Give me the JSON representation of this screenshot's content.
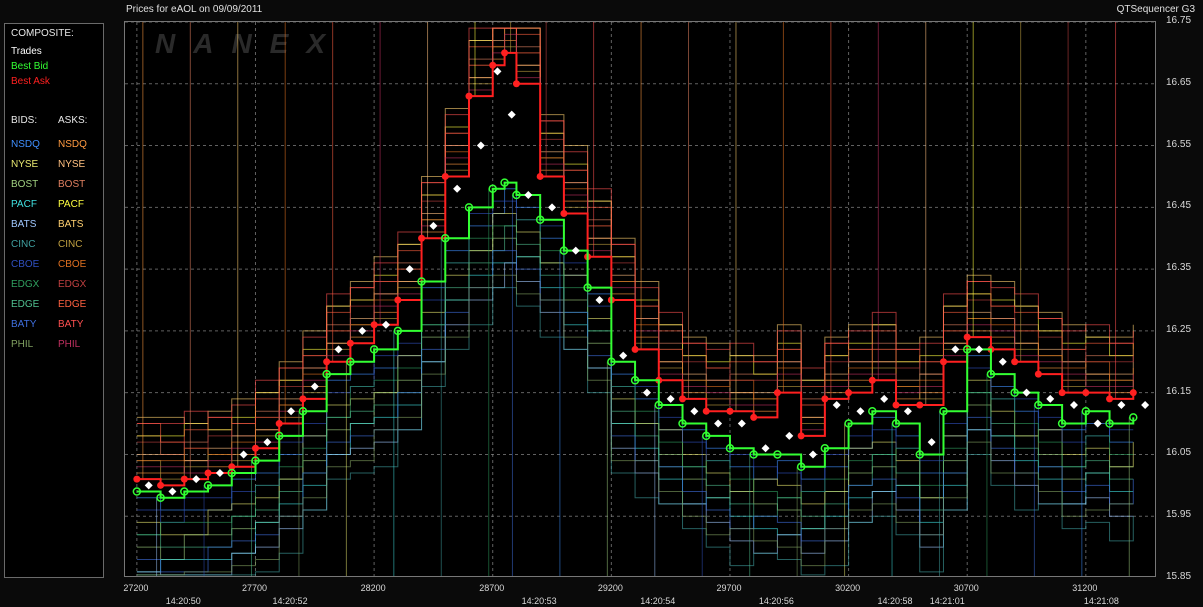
{
  "header": {
    "title_left": "Prices for  eAOL  on  09/09/2011",
    "title_right": "QTSequencer G3"
  },
  "legend": {
    "composite_label": "COMPOSITE:",
    "composite": [
      {
        "name": "Trades",
        "color": "#ffffff"
      },
      {
        "name": "Best Bid",
        "color": "#33ff33"
      },
      {
        "name": "Best Ask",
        "color": "#ff2020"
      }
    ],
    "bids_label": "BIDS:",
    "asks_label": "ASKS:",
    "exchanges": [
      {
        "bid": "NSDQ",
        "ask": "NSDQ",
        "bid_color": "#3f8fff",
        "ask_color": "#ff9a40"
      },
      {
        "bid": "NYSE",
        "ask": "NYSE",
        "bid_color": "#e8e870",
        "ask_color": "#ffc080"
      },
      {
        "bid": "BOST",
        "ask": "BOST",
        "bid_color": "#a0d080",
        "ask_color": "#e08060"
      },
      {
        "bid": "PACF",
        "ask": "PACF",
        "bid_color": "#40e0e0",
        "ask_color": "#ffff40"
      },
      {
        "bid": "BATS",
        "ask": "BATS",
        "bid_color": "#a0c8ff",
        "ask_color": "#ffd070"
      },
      {
        "bid": "CINC",
        "ask": "CINC",
        "bid_color": "#40a0a0",
        "ask_color": "#c0a040"
      },
      {
        "bid": "CBOE",
        "ask": "CBOE",
        "bid_color": "#3050c0",
        "ask_color": "#e07020"
      },
      {
        "bid": "EDGX",
        "ask": "EDGX",
        "bid_color": "#30a060",
        "ask_color": "#c04040"
      },
      {
        "bid": "EDGE",
        "ask": "EDGE",
        "bid_color": "#50c090",
        "ask_color": "#ff6040"
      },
      {
        "bid": "BATY",
        "ask": "BATY",
        "bid_color": "#4070e0",
        "ask_color": "#ff5050"
      },
      {
        "bid": "PHIL",
        "ask": "PHIL",
        "bid_color": "#80a060",
        "ask_color": "#c03060"
      }
    ]
  },
  "watermark": "NANEX",
  "chart_data": {
    "type": "line",
    "title": "Prices for  eAOL  on  09/09/2011",
    "xlim": [
      27150,
      31500
    ],
    "ylim": [
      15.85,
      16.75
    ],
    "y_ticks": [
      "16.75",
      "16.65",
      "16.55",
      "16.45",
      "16.35",
      "16.25",
      "16.15",
      "16.05",
      "15.95",
      "15.85"
    ],
    "x_ticks": [
      "27200",
      "27700",
      "28200",
      "28700",
      "29200",
      "29700",
      "30200",
      "30700",
      "31200"
    ],
    "time_ticks": [
      {
        "label": "14:20:50",
        "x": 27400
      },
      {
        "label": "14:20:52",
        "x": 27850
      },
      {
        "label": "14:20:53",
        "x": 28900
      },
      {
        "label": "14:20:54",
        "x": 29400
      },
      {
        "label": "14:20:56",
        "x": 29900
      },
      {
        "label": "14:20:58",
        "x": 30400
      },
      {
        "label": "14:21:01",
        "x": 30620
      },
      {
        "label": "14:21:08",
        "x": 31270
      }
    ],
    "series": [
      {
        "name": "Best Ask",
        "color": "#ff2020",
        "x": [
          27200,
          27300,
          27400,
          27500,
          27600,
          27700,
          27800,
          27900,
          28000,
          28100,
          28200,
          28300,
          28400,
          28500,
          28600,
          28700,
          28750,
          28800,
          28900,
          29000,
          29100,
          29200,
          29300,
          29400,
          29500,
          29600,
          29700,
          29800,
          29900,
          30000,
          30100,
          30200,
          30300,
          30400,
          30500,
          30600,
          30700,
          30800,
          30900,
          31000,
          31100,
          31200,
          31300,
          31400
        ],
        "values": [
          16.01,
          16.0,
          16.01,
          16.02,
          16.03,
          16.06,
          16.1,
          16.14,
          16.2,
          16.23,
          16.26,
          16.3,
          16.4,
          16.5,
          16.63,
          16.68,
          16.7,
          16.65,
          16.5,
          16.44,
          16.37,
          16.3,
          16.22,
          16.17,
          16.14,
          16.12,
          16.12,
          16.11,
          16.15,
          16.08,
          16.14,
          16.15,
          16.17,
          16.13,
          16.13,
          16.2,
          16.24,
          16.22,
          16.2,
          16.18,
          16.15,
          16.15,
          16.14,
          16.15
        ]
      },
      {
        "name": "Best Bid",
        "color": "#33ff33",
        "x": [
          27200,
          27300,
          27400,
          27500,
          27600,
          27700,
          27800,
          27900,
          28000,
          28100,
          28200,
          28300,
          28400,
          28500,
          28600,
          28700,
          28750,
          28800,
          28900,
          29000,
          29100,
          29200,
          29300,
          29400,
          29500,
          29600,
          29700,
          29800,
          29900,
          30000,
          30100,
          30200,
          30300,
          30400,
          30500,
          30600,
          30700,
          30800,
          30900,
          31000,
          31100,
          31200,
          31300,
          31400
        ],
        "values": [
          15.99,
          15.98,
          15.99,
          16.0,
          16.02,
          16.04,
          16.08,
          16.12,
          16.18,
          16.2,
          16.22,
          16.25,
          16.33,
          16.4,
          16.45,
          16.48,
          16.49,
          16.47,
          16.43,
          16.38,
          16.32,
          16.2,
          16.17,
          16.13,
          16.1,
          16.08,
          16.06,
          16.05,
          16.05,
          16.03,
          16.06,
          16.1,
          16.12,
          16.1,
          16.05,
          16.12,
          16.22,
          16.18,
          16.15,
          16.13,
          16.1,
          16.12,
          16.1,
          16.11
        ]
      },
      {
        "name": "Trades",
        "color": "#ffffff",
        "x": [
          27250,
          27350,
          27450,
          27550,
          27650,
          27750,
          27850,
          27950,
          28050,
          28150,
          28250,
          28350,
          28450,
          28550,
          28650,
          28720,
          28780,
          28850,
          28950,
          29050,
          29150,
          29250,
          29350,
          29450,
          29550,
          29650,
          29750,
          29850,
          29950,
          30050,
          30150,
          30250,
          30350,
          30450,
          30550,
          30650,
          30750,
          30850,
          30950,
          31050,
          31150,
          31250,
          31350,
          31450
        ],
        "values": [
          16.0,
          15.99,
          16.01,
          16.02,
          16.05,
          16.07,
          16.12,
          16.16,
          16.22,
          16.25,
          16.26,
          16.35,
          16.42,
          16.48,
          16.55,
          16.67,
          16.6,
          16.47,
          16.45,
          16.38,
          16.3,
          16.21,
          16.15,
          16.14,
          16.12,
          16.1,
          16.1,
          16.06,
          16.08,
          16.05,
          16.13,
          16.12,
          16.14,
          16.12,
          16.07,
          16.22,
          16.22,
          16.2,
          16.15,
          16.14,
          16.13,
          16.1,
          16.13,
          16.13
        ]
      }
    ]
  }
}
